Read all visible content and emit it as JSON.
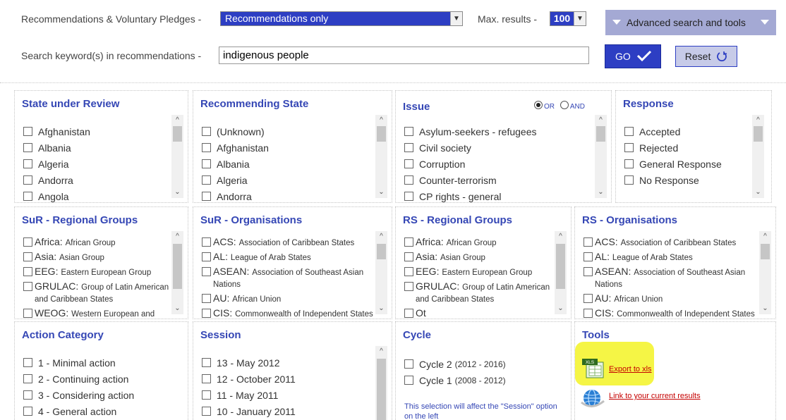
{
  "filter_bar": {
    "type_label": "Recommendations & Voluntary Pledges -",
    "type_value": "Recommendations only",
    "max_label": "Max. results -",
    "max_value": "100",
    "advanced_label": "Advanced search and tools",
    "keyword_label": "Search keyword(s) in recommendations -",
    "keyword_value": "indigenous people",
    "go_label": "GO",
    "reset_label": "Reset"
  },
  "panels": {
    "state_under_review": {
      "title": "State under Review",
      "items": [
        "Afghanistan",
        "Albania",
        "Algeria",
        "Andorra",
        "Angola"
      ]
    },
    "recommending_state": {
      "title": "Recommending State",
      "items": [
        "(Unknown)",
        "Afghanistan",
        "Albania",
        "Algeria",
        "Andorra"
      ]
    },
    "issue": {
      "title": "Issue",
      "or_label": "OR",
      "and_label": "AND",
      "items": [
        "Asylum-seekers - refugees",
        "Civil society",
        "Corruption",
        "Counter-terrorism",
        "CP rights - general"
      ]
    },
    "response": {
      "title": "Response",
      "items": [
        "Accepted",
        "Rejected",
        "General Response",
        "No Response"
      ]
    },
    "sur_regional": {
      "title": "SuR - Regional Groups",
      "items": [
        {
          "code": "Africa:",
          "desc": "African Group"
        },
        {
          "code": "Asia:",
          "desc": "Asian Group"
        },
        {
          "code": "EEG:",
          "desc": "Eastern European Group"
        },
        {
          "code": "GRULAC:",
          "desc": "Group of Latin American and Caribbean States"
        },
        {
          "code": "WEOG:",
          "desc": "Western European and others Group"
        }
      ]
    },
    "sur_orgs": {
      "title": "SuR - Organisations",
      "items": [
        {
          "code": "ACS:",
          "desc": "Association of Caribbean States"
        },
        {
          "code": "AL:",
          "desc": "League of Arab States"
        },
        {
          "code": "ASEAN:",
          "desc": "Association of Southeast Asian Nations"
        },
        {
          "code": "AU:",
          "desc": "African Union"
        },
        {
          "code": "CIS:",
          "desc": "Commonwealth of Independent States"
        }
      ]
    },
    "rs_regional": {
      "title": "RS - Regional Groups",
      "items": [
        {
          "code": "Africa:",
          "desc": "African Group"
        },
        {
          "code": "Asia:",
          "desc": "Asian Group"
        },
        {
          "code": "EEG:",
          "desc": "Eastern European Group"
        },
        {
          "code": "GRULAC:",
          "desc": "Group of Latin American and Caribbean States"
        },
        {
          "code": "Ot",
          "desc": ""
        }
      ]
    },
    "rs_orgs": {
      "title": "RS - Organisations",
      "items": [
        {
          "code": "ACS:",
          "desc": "Association of Caribbean States"
        },
        {
          "code": "AL:",
          "desc": "League of Arab States"
        },
        {
          "code": "ASEAN:",
          "desc": "Association of Southeast Asian Nations"
        },
        {
          "code": "AU:",
          "desc": "African Union"
        },
        {
          "code": "CIS:",
          "desc": "Commonwealth of Independent States"
        }
      ]
    },
    "action_category": {
      "title": "Action Category",
      "items": [
        "1 - Minimal action",
        "2 - Continuing action",
        "3 - Considering action",
        "4 - General action"
      ]
    },
    "session": {
      "title": "Session",
      "items": [
        "13 - May 2012",
        "12 - October 2011",
        "11 - May 2011",
        "10 - January 2011"
      ]
    },
    "cycle": {
      "title": "Cycle",
      "items": [
        {
          "label": "Cycle 2",
          "years": "(2012 - 2016)"
        },
        {
          "label": "Cycle 1",
          "years": "(2008 - 2012)"
        }
      ],
      "note": "This selection will affect the \"Session\" option on the left"
    },
    "tools": {
      "title": "Tools",
      "export_label": "Export to xls",
      "link_label": "Link to your current results",
      "xls_badge": "XLS"
    }
  },
  "colors": {
    "accent": "#2d3ec3",
    "title": "#3547b5",
    "link": "#c50000",
    "highlight": "#f5f545"
  }
}
